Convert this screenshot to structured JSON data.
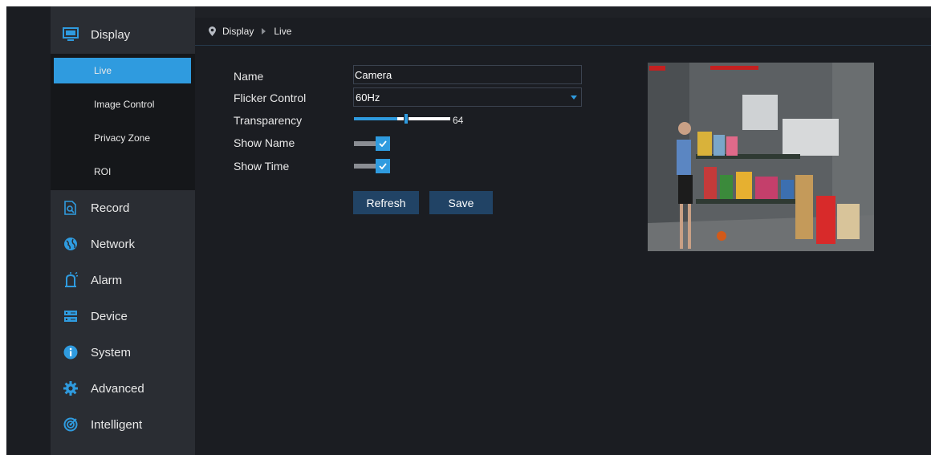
{
  "sidebar": {
    "items": [
      {
        "label": "Display",
        "icon": "monitor-icon"
      },
      {
        "label": "Record",
        "icon": "record-icon"
      },
      {
        "label": "Network",
        "icon": "globe-icon"
      },
      {
        "label": "Alarm",
        "icon": "alarm-icon"
      },
      {
        "label": "Device",
        "icon": "storage-icon"
      },
      {
        "label": "System",
        "icon": "info-icon"
      },
      {
        "label": "Advanced",
        "icon": "gear-icon"
      },
      {
        "label": "Intelligent",
        "icon": "intelligent-icon"
      }
    ],
    "submenu": [
      {
        "label": "Live",
        "active": true
      },
      {
        "label": "Image Control"
      },
      {
        "label": "Privacy Zone"
      },
      {
        "label": "ROI"
      }
    ]
  },
  "breadcrumb": {
    "section": "Display",
    "page": "Live"
  },
  "form": {
    "name_label": "Name",
    "name_value": "Camera",
    "flicker_label": "Flicker Control",
    "flicker_value": "60Hz",
    "transparency_label": "Transparency",
    "transparency_value": "64",
    "transparency_fraction": 0.45,
    "show_name_label": "Show Name",
    "show_name_checked": true,
    "show_time_label": "Show Time",
    "show_time_checked": true
  },
  "buttons": {
    "refresh": "Refresh",
    "save": "Save"
  },
  "colors": {
    "accent": "#2f9bdf",
    "button": "#214365",
    "sidebar": "#2a2d33",
    "background": "#1b1d22"
  }
}
